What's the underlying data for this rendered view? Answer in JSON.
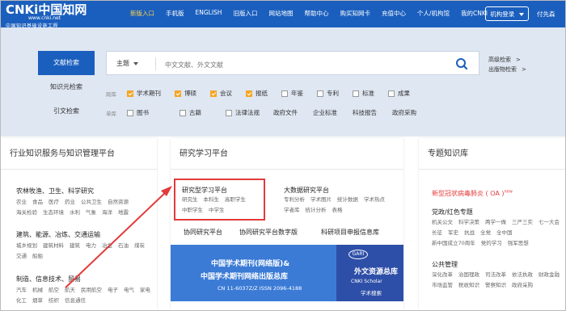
{
  "logo": {
    "main": "CNKi中国知网",
    "url": "www.cnki.net",
    "sub": "中国知识基础设施工程"
  },
  "nav": [
    {
      "label": "新版入口",
      "active": true
    },
    {
      "label": "手机版"
    },
    {
      "label": "ENGLISH"
    },
    {
      "label": "旧版入口"
    },
    {
      "label": "网站地图"
    },
    {
      "label": "帮助中心"
    },
    {
      "label": "购买知网卡"
    },
    {
      "label": "充值中心"
    },
    {
      "label": "个人/机构馆"
    },
    {
      "label": "我的CNKI"
    }
  ],
  "login_label": "机构登录",
  "user_label": "付先森",
  "side_tabs": [
    "文献检索",
    "知识元检索",
    "引文检索"
  ],
  "search": {
    "field": "主题",
    "placeholder": "中文文献、外文文献",
    "icon": "search-icon"
  },
  "advanced": {
    "adv_label": "高级检索",
    "pub_label": "出版物检索",
    "arrow": ">"
  },
  "crosslib": {
    "label": "跨库",
    "items": [
      {
        "label": "学术期刊",
        "checked": true
      },
      {
        "label": "博硕",
        "checked": true
      },
      {
        "label": "会议",
        "checked": true
      },
      {
        "label": "报纸",
        "checked": true
      },
      {
        "label": "年鉴",
        "checked": false
      },
      {
        "label": "专利",
        "checked": false
      },
      {
        "label": "标准",
        "checked": false
      },
      {
        "label": "成果",
        "checked": false
      }
    ]
  },
  "singlelib": {
    "label": "单库",
    "checkitems": [
      {
        "label": "图书",
        "checked": false
      },
      {
        "label": "古籍",
        "checked": false
      },
      {
        "label": "法律法规",
        "checked": false
      }
    ],
    "plain": [
      "政府文件",
      "企业标准",
      "科技报告",
      "政府采购"
    ]
  },
  "panel1": {
    "title": "行业知识服务与知识管理平台",
    "cat1": "农林牧渔、卫生、科学研究",
    "cat1_links": [
      "农业",
      "食品",
      "医疗",
      "药业",
      "公共卫生",
      "自然资源",
      "海关检验",
      "生态环境",
      "水利",
      "气象",
      "海洋",
      "地震"
    ],
    "cat2": "建筑、能源、冶炼、交通运输",
    "cat2_links": [
      "城乡规划",
      "建筑材料",
      "建筑",
      "电力",
      "冶金",
      "石油",
      "煤炭",
      "交通",
      "船舶"
    ],
    "cat3": "制造、信息技术、贸易",
    "cat3_links": [
      "汽车",
      "机械",
      "航空",
      "航天",
      "民用航空",
      "电子",
      "电气",
      "家电",
      "化工",
      "烟草",
      "纺织",
      "信息通信"
    ]
  },
  "panel2": {
    "title": "研究学习平台",
    "study_title": "研究型学习平台",
    "study_links": [
      "研究生",
      "本科生",
      "高职学生",
      "中职学生",
      "中学生"
    ],
    "bigdata_title": "大数据研究平台",
    "bigdata_links": [
      "专利分析",
      "学术图片",
      "统计数据",
      "学术热点",
      "学者库",
      "统计分析",
      "表格"
    ],
    "row3": [
      "协同研究平台",
      "协同研究平台数字版",
      "科研项目申报信息库"
    ],
    "banner1_t1": "中国学术期刊(网络版)&",
    "banner1_t2": "中国学术期刊网络出版总库",
    "banner1_t3": "CN 11-6037Z/Z    ISSN 2096-4188",
    "banner2_gari": "GARI",
    "banner2_w1": "外文资源总库",
    "banner2_w2": "CNKI Scholar",
    "banner2_w3": "学术搜索"
  },
  "panel3": {
    "title": "专题知识库",
    "promo": "新型冠状病毒肺炎 ( OA )",
    "promo_badge": "new",
    "cat1": "党政/红色专题",
    "cat1_links": [
      "机关公文",
      "科学决策",
      "两学一做",
      "三严三实",
      "七一大会",
      "长征",
      "军史",
      "抗战",
      "全党",
      "全中国",
      "新中国成立70周年",
      "党的学习",
      "强军思想"
    ],
    "cat2": "公共管理",
    "cat2_links": [
      "深化改革",
      "治国理政",
      "司法改革",
      "依法执政",
      "财政金融",
      "市场监管",
      "税收知识",
      "警察知识",
      "政府采购"
    ]
  }
}
